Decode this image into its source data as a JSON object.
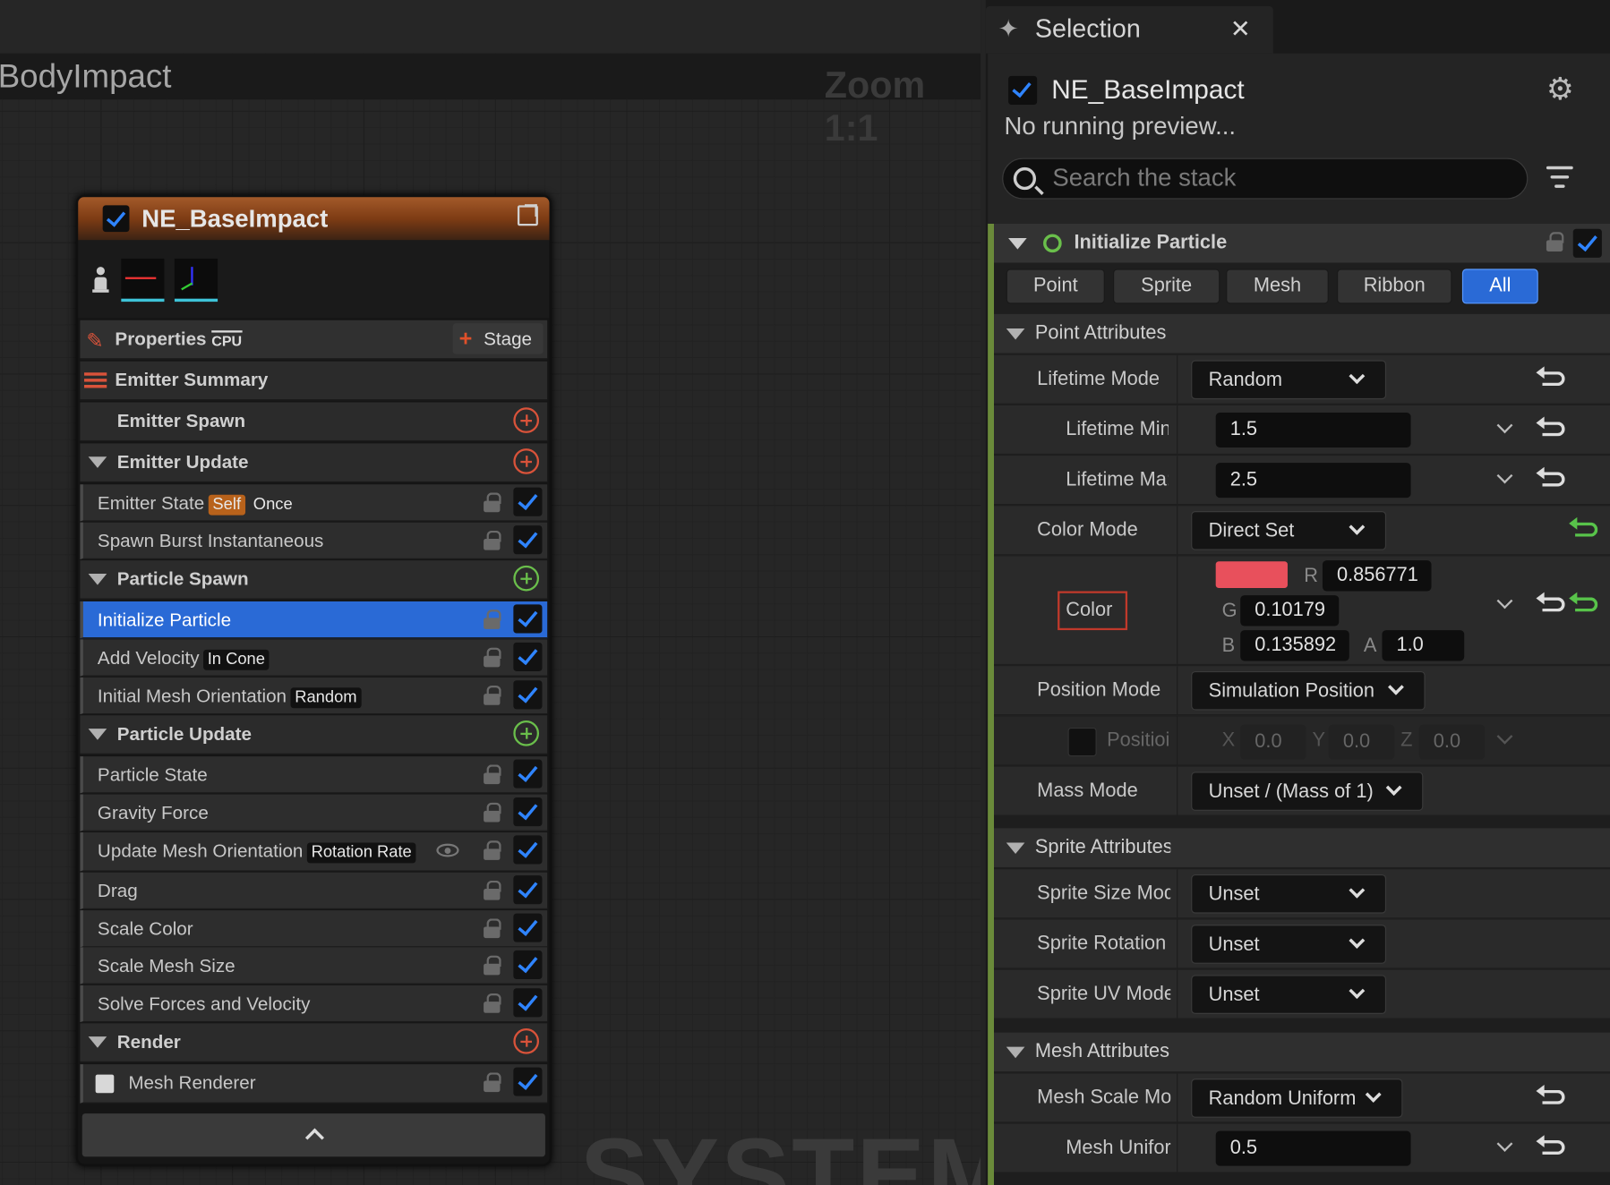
{
  "graph": {
    "title": "BodyImpact",
    "zoom": "Zoom 1:1",
    "watermark": "SYSTEM"
  },
  "node": {
    "title": "NE_BaseImpact",
    "properties_label": "Properties",
    "sim_target": "CPU",
    "stage_button": "Stage",
    "sections": [
      {
        "label": "Emitter Summary"
      },
      {
        "label": "Emitter Spawn"
      },
      {
        "label": "Emitter Update",
        "modules": [
          {
            "label": "Emitter State",
            "tags": [
              "Self",
              "Once"
            ]
          },
          {
            "label": "Spawn Burst Instantaneous"
          }
        ]
      },
      {
        "label": "Particle Spawn",
        "modules": [
          {
            "label": "Initialize Particle",
            "selected": true
          },
          {
            "label": "Add Velocity",
            "tags": [
              "In Cone"
            ]
          },
          {
            "label": "Initial Mesh Orientation",
            "tags": [
              "Random"
            ]
          }
        ]
      },
      {
        "label": "Particle Update",
        "modules": [
          {
            "label": "Particle State"
          },
          {
            "label": "Gravity Force"
          },
          {
            "label": "Update Mesh Orientation",
            "tags": [
              "Rotation Rate"
            ]
          },
          {
            "label": "Drag"
          },
          {
            "label": "Scale Color"
          },
          {
            "label": "Scale Mesh Size"
          },
          {
            "label": "Solve Forces and Velocity"
          }
        ]
      },
      {
        "label": "Render",
        "modules": [
          {
            "label": "Mesh Renderer"
          }
        ]
      }
    ]
  },
  "panel": {
    "tab_label": "Selection",
    "emitter_name": "NE_BaseImpact",
    "preview_status": "No running preview...",
    "search_placeholder": "Search the stack",
    "module_title": "Initialize Particle",
    "filters": [
      "Point",
      "Sprite",
      "Mesh",
      "Ribbon",
      "All"
    ],
    "active_filter": "All",
    "point_section": "Point Attributes",
    "lifetime_mode": {
      "label": "Lifetime Mode",
      "value": "Random"
    },
    "lifetime_min": {
      "label": "Lifetime Min",
      "value": "1.5"
    },
    "lifetime_max": {
      "label": "Lifetime Ma:",
      "value": "2.5"
    },
    "color_mode": {
      "label": "Color Mode",
      "value": "Direct Set"
    },
    "color": {
      "label": "Color",
      "swatch": "#e8505c",
      "r": "0.856771",
      "g": "0.10179",
      "b": "0.135892",
      "a": "1.0",
      "r_label": "R",
      "g_label": "G",
      "b_label": "B",
      "a_label": "A"
    },
    "position_mode": {
      "label": "Position Mode",
      "value": "Simulation Position"
    },
    "position": {
      "label": "Positioi",
      "x_label": "X",
      "y_label": "Y",
      "z_label": "Z",
      "x": "0.0",
      "y": "0.0",
      "z": "0.0"
    },
    "mass_mode": {
      "label": "Mass Mode",
      "value": "Unset / (Mass of 1)"
    },
    "sprite_section": "Sprite Attributes",
    "sprite_size": {
      "label": "Sprite Size Mod",
      "value": "Unset"
    },
    "sprite_rotation": {
      "label": "Sprite Rotation",
      "value": "Unset"
    },
    "sprite_uv": {
      "label": "Sprite UV Mode",
      "value": "Unset"
    },
    "mesh_section": "Mesh Attributes",
    "mesh_scale_mode": {
      "label": "Mesh Scale Mo",
      "value": "Random Uniform"
    },
    "mesh_uniform": {
      "label": "Mesh Unifor",
      "value": "0.5"
    }
  },
  "colors": {
    "accent": "#2a6ad6",
    "header": "#8a4a1e",
    "add_orange": "#d9533a",
    "add_green": "#6abf4b"
  }
}
